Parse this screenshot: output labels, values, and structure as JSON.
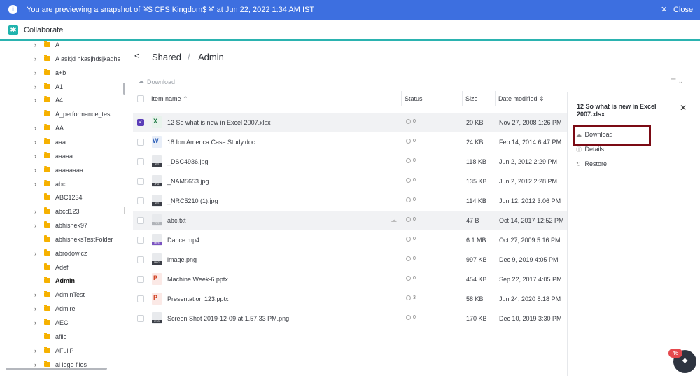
{
  "banner": {
    "message": "You are previewing a snapshot of '¥$ CFS Kingdom$ ¥' at Jun 22, 2022 1:34 AM IST",
    "close_label": "Close"
  },
  "app": {
    "title": "Collaborate"
  },
  "sidebar": {
    "items": [
      {
        "label": "A",
        "chevron": true
      },
      {
        "label": "A askjd hkasjhdsjkaghs",
        "chevron": true
      },
      {
        "label": "a+b",
        "chevron": true
      },
      {
        "label": "A1",
        "chevron": true
      },
      {
        "label": "A4",
        "chevron": true
      },
      {
        "label": "A_performance_test",
        "chevron": false
      },
      {
        "label": "AA",
        "chevron": true
      },
      {
        "label": "aaa",
        "chevron": true
      },
      {
        "label": "aaaaa",
        "chevron": true
      },
      {
        "label": "aaaaaaaa",
        "chevron": true
      },
      {
        "label": "abc",
        "chevron": true
      },
      {
        "label": "ABC1234",
        "chevron": false
      },
      {
        "label": "abcd123",
        "chevron": true
      },
      {
        "label": "abhishek97",
        "chevron": true
      },
      {
        "label": "abhisheksTestFolder",
        "chevron": false
      },
      {
        "label": "abrodowicz",
        "chevron": true
      },
      {
        "label": "Adef",
        "chevron": false
      },
      {
        "label": "Admin",
        "chevron": false,
        "selected": true
      },
      {
        "label": "AdminTest",
        "chevron": true
      },
      {
        "label": "Admire",
        "chevron": true
      },
      {
        "label": "AEC",
        "chevron": true
      },
      {
        "label": "afile",
        "chevron": false
      },
      {
        "label": "AFullP",
        "chevron": true
      },
      {
        "label": "ai logo files",
        "chevron": true
      }
    ]
  },
  "breadcrumb": {
    "root": "Shared",
    "separator": "/",
    "current": "Admin"
  },
  "toolbar": {
    "download_label": "Download"
  },
  "table": {
    "headers": {
      "name": "Item name",
      "status": "Status",
      "size": "Size",
      "date": "Date modified"
    },
    "rows": [
      {
        "name": "12 So what is new in Excel 2007.xlsx",
        "type": "xlsx",
        "status": "0",
        "size": "20 KB",
        "date": "Nov 27, 2008 1:26 PM",
        "checked": true,
        "highlight": true
      },
      {
        "name": "18 Ion America Case Study.doc",
        "type": "doc",
        "status": "0",
        "size": "24 KB",
        "date": "Feb 14, 2014 6:47 PM"
      },
      {
        "name": "_DSC4936.jpg",
        "type": "jpg",
        "tag": "JPG",
        "status": "0",
        "size": "118 KB",
        "date": "Jun 2, 2012 2:29 PM"
      },
      {
        "name": "_NAM5653.jpg",
        "type": "jpg",
        "tag": "JPG",
        "status": "0",
        "size": "135 KB",
        "date": "Jun 2, 2012 2:28 PM"
      },
      {
        "name": "_NRC5210 (1).jpg",
        "type": "jpg",
        "tag": "JPG",
        "status": "0",
        "size": "114 KB",
        "date": "Jun 12, 2012 3:06 PM"
      },
      {
        "name": "abc.txt",
        "type": "txt",
        "tag": "TXT",
        "status": "0",
        "size": "47 B",
        "date": "Oct 14, 2017 12:52 PM",
        "highlight": true,
        "hover_cloud": true
      },
      {
        "name": "Dance.mp4",
        "type": "mp4",
        "tag": "MP4",
        "status": "0",
        "size": "6.1 MB",
        "date": "Oct 27, 2009 5:16 PM"
      },
      {
        "name": "image.png",
        "type": "png",
        "tag": "PNG",
        "status": "0",
        "size": "997 KB",
        "date": "Dec 9, 2019 4:05 PM"
      },
      {
        "name": "Machine Week-6.pptx",
        "type": "pptx",
        "status": "0",
        "size": "454 KB",
        "date": "Sep 22, 2017 4:05 PM"
      },
      {
        "name": "Presentation 123.pptx",
        "type": "pptx",
        "status": "3",
        "size": "58 KB",
        "date": "Jun 24, 2020 8:18 PM"
      },
      {
        "name": "Screen Shot 2019-12-09 at 1.57.33 PM.png",
        "type": "png",
        "tag": "PNG",
        "status": "0",
        "size": "170 KB",
        "date": "Dec 10, 2019 3:30 PM"
      }
    ]
  },
  "panel": {
    "title": "12 So what is new in Excel 2007.xlsx",
    "actions": [
      {
        "label": "Download",
        "icon": "cloud-download-icon"
      },
      {
        "label": "Details",
        "icon": "info-icon"
      },
      {
        "label": "Restore",
        "icon": "restore-icon"
      }
    ]
  },
  "chat": {
    "badge": "46"
  }
}
